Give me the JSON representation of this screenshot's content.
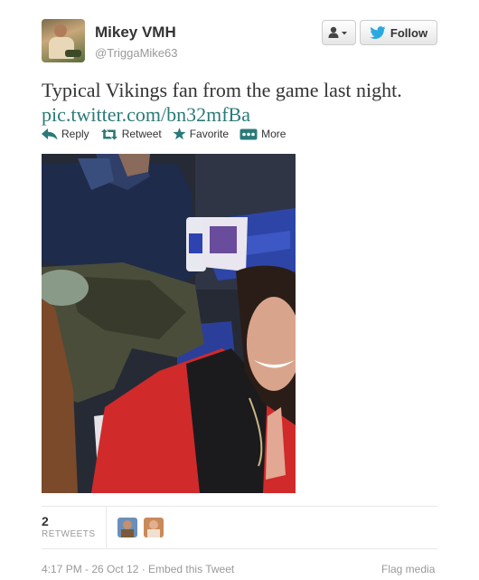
{
  "user": {
    "fullname": "Mikey VMH",
    "screenname": "@TriggaMike63"
  },
  "header_buttons": {
    "follow_label": "Follow"
  },
  "tweet": {
    "text": "Typical Vikings fan from the game last night.",
    "link": "pic.twitter.com/bn32mfBa"
  },
  "actions": {
    "reply": "Reply",
    "retweet": "Retweet",
    "favorite": "Favorite",
    "more": "More"
  },
  "stats": {
    "retweet_count": "2",
    "retweet_label": "RETWEETS"
  },
  "footer": {
    "meta": "4:17 PM - 26 Oct 12 · Embed this Tweet",
    "flag": "Flag media"
  },
  "colors": {
    "link": "#2a7a79",
    "action_icon": "#2a7a79",
    "twitter_bird": "#2aa9e0",
    "muted": "#999999"
  },
  "icons": [
    "person-dropdown-icon",
    "twitter-bird-icon",
    "reply-icon",
    "retweet-icon",
    "star-icon",
    "more-icon"
  ]
}
